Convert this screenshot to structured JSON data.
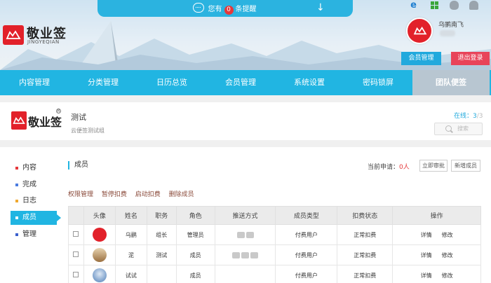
{
  "header": {
    "notice": {
      "prefix": "您有",
      "count": "0",
      "suffix": "条提醒"
    },
    "logo": {
      "name": "敬业签",
      "sub": "JINGYEQIAN"
    },
    "platforms": [
      "ie-icon",
      "windows-icon",
      "apple-icon",
      "android-icon"
    ],
    "user": {
      "name": "乌鹂南飞"
    },
    "member_btn": "会员管理",
    "logout_btn": "退出登录"
  },
  "nav": {
    "items": [
      "内容管理",
      "分类管理",
      "日历总览",
      "会员管理",
      "系统设置",
      "密码锁屏",
      "团队便签"
    ],
    "active_index": 6
  },
  "team": {
    "logo_text": "敬业签",
    "name": "测试",
    "desc": "云便签测试组",
    "online_label": "在线：",
    "online_count": "3",
    "online_total": "/3",
    "search_placeholder": "搜索"
  },
  "sidebar": {
    "items": [
      {
        "label": "内容",
        "color": "#e5383b"
      },
      {
        "label": "完成",
        "color": "#4a7be0"
      },
      {
        "label": "日志",
        "color": "#f0a830"
      },
      {
        "label": "成员",
        "color": "#ffffff"
      },
      {
        "label": "管理",
        "color": "#3a5fcd"
      }
    ],
    "active_index": 3
  },
  "members": {
    "title": "成员",
    "pending_label": "当前申请：",
    "pending_count": "0",
    "pending_unit": "人",
    "approve_btn": "立即审批",
    "add_btn": "新增成员",
    "actions": [
      "权限管理",
      "暂停扣费",
      "启动扣费",
      "删除成员"
    ],
    "columns": [
      "",
      "头像",
      "姓名",
      "职务",
      "角色",
      "推送方式",
      "成员类型",
      "扣费状态",
      "操作"
    ],
    "rows": [
      {
        "name": "乌鹂",
        "title": "组长",
        "role": "管理员",
        "type": "付费用户",
        "status": "正常扣费",
        "detail": "详情",
        "edit": "修改",
        "avatar_color": "#e2212a",
        "push": 2
      },
      {
        "name": "泥",
        "title": "测试",
        "role": "成员",
        "type": "付费用户",
        "status": "正常扣费",
        "detail": "详情",
        "edit": "修改",
        "avatar_color": "#b58a5a",
        "push": 3
      },
      {
        "name": "试试",
        "title": "",
        "role": "成员",
        "type": "付费用户",
        "status": "正常扣费",
        "detail": "详情",
        "edit": "修改",
        "avatar_color": "#4d7eb8",
        "push": 0
      }
    ]
  },
  "colors": {
    "accent": "#21b5e2",
    "danger": "#e8445a",
    "brand": "#e2212a"
  }
}
